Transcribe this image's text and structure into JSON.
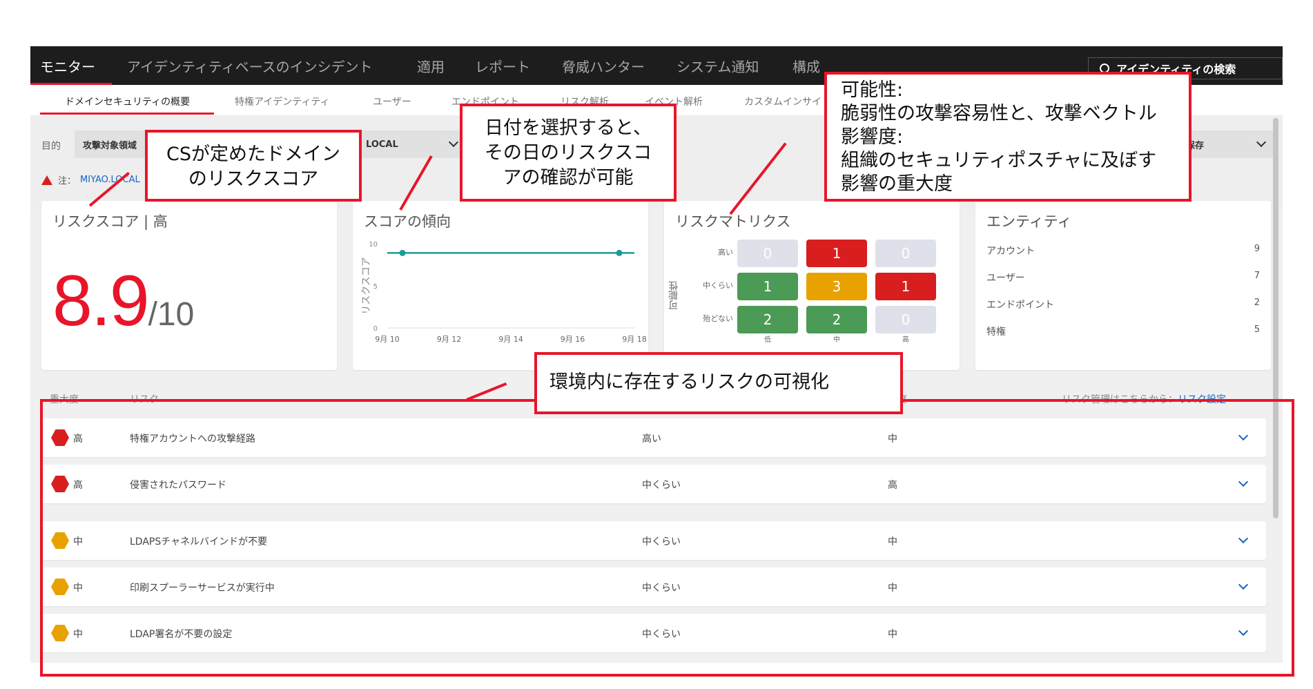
{
  "nav": {
    "tabs": [
      "モニター",
      "アイデンティティベースのインシデント",
      "適用",
      "レポート",
      "脅威ハンター",
      "システム通知",
      "構成"
    ],
    "search_placeholder": "アイデンティティの検索"
  },
  "subnav": {
    "tabs": [
      "ドメインセキュリティの概要",
      "特権アイデンティティ",
      "ユーザー",
      "エンドポイント",
      "リスク解析",
      "イベント解析",
      "カスタムインサイ"
    ]
  },
  "filter": {
    "label": "目的",
    "select1": "攻撃対象領域",
    "select2": "LOCAL",
    "save_label": "保存",
    "note_prefix": "注：",
    "note_link": "MIYAO.LOCAL"
  },
  "risk_score": {
    "title": "リスクスコア | 高",
    "value": "8.9",
    "max": "/10"
  },
  "trend": {
    "title": "スコアの傾向"
  },
  "chart_data": {
    "type": "line",
    "ylabel": "リスクスコア",
    "ylim": [
      0,
      10
    ],
    "yticks": [
      "0",
      "5",
      "10"
    ],
    "x": [
      "9月 10",
      "9月 12",
      "9月 14",
      "9月 16",
      "9月 18"
    ],
    "series": [
      {
        "points": [
          {
            "x": "9月 10",
            "y": 8.9
          },
          {
            "x": "9月 18",
            "y": 8.9
          }
        ]
      }
    ],
    "color": "#1a9c99"
  },
  "matrix": {
    "title": "リスクマトリクス",
    "y_axis": "可能性",
    "rows": [
      "高い",
      "中くらい",
      "殆どない"
    ],
    "cols": [
      "低",
      "中",
      "高"
    ],
    "values": [
      [
        0,
        1,
        0
      ],
      [
        1,
        3,
        1
      ],
      [
        2,
        2,
        0
      ]
    ],
    "colors": {
      "empty": "#dfe1ea",
      "low": "#4b9a56",
      "medium": "#e8a200",
      "high": "#d81e1e"
    }
  },
  "entities": {
    "title": "エンティティ",
    "items": [
      {
        "label": "アカウント",
        "count": "9"
      },
      {
        "label": "ユーザー",
        "count": "7"
      },
      {
        "label": "エンドポイント",
        "count": "2"
      },
      {
        "label": "特権",
        "count": "5"
      }
    ]
  },
  "table": {
    "headers": {
      "severity": "重大度",
      "risk": "リスク",
      "impact": "度"
    },
    "manage_prefix": "リスク管理はこちらから：",
    "manage_link": "リスク設定",
    "rows": [
      {
        "severity": "高",
        "risk": "特権アカウントへの攻撃経路",
        "likelihood": "高い",
        "impact": "中",
        "color": "#d81e1e"
      },
      {
        "severity": "高",
        "risk": "侵害されたパスワード",
        "likelihood": "中くらい",
        "impact": "高",
        "color": "#d81e1e"
      },
      {
        "severity": "中",
        "risk": "LDAPSチャネルバインドが不要",
        "likelihood": "中くらい",
        "impact": "中",
        "color": "#e8a200"
      },
      {
        "severity": "中",
        "risk": "印刷スプーラーサービスが実行中",
        "likelihood": "中くらい",
        "impact": "中",
        "color": "#e8a200"
      },
      {
        "severity": "中",
        "risk": "LDAP署名が不要の設定",
        "likelihood": "中くらい",
        "impact": "中",
        "color": "#e8a200"
      }
    ]
  },
  "annotations": {
    "a1": [
      "CSが定めたドメイン",
      "のリスクスコア"
    ],
    "a2": [
      "日付を選択すると、",
      "その日のリスクスコ",
      "アの確認が可能"
    ],
    "a3": [
      "可能性:",
      "脆弱性の攻撃容易性と、攻撃ベクトル",
      "影響度:",
      "組織のセキュリティポスチャに及ぼす",
      "影響の重大度"
    ],
    "a4": [
      "環境内に存在するリスクの可視化"
    ]
  }
}
